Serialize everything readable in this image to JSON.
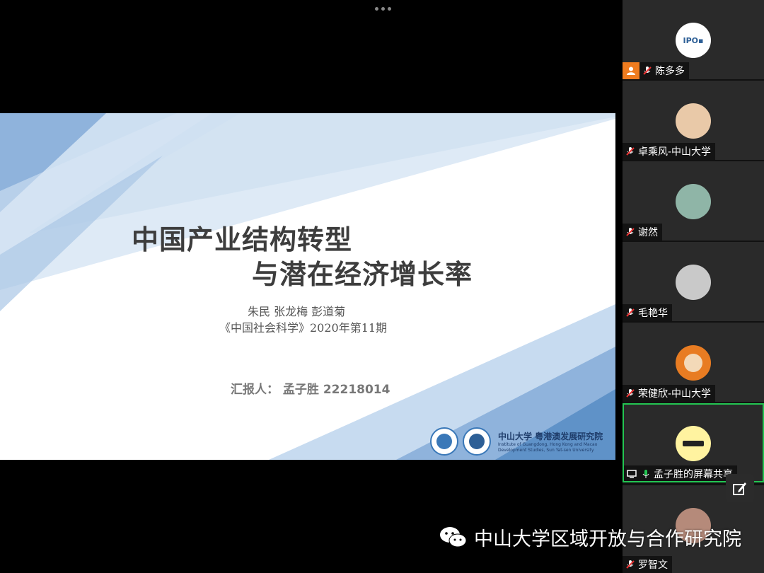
{
  "slide": {
    "title_line1": "中国产业结构转型",
    "title_line2": "与潜在经济增长率",
    "authors": "朱民 张龙梅 彭道菊",
    "journal": "《中国社会科学》2020年第11期",
    "presenter": "汇报人： 孟子胜 22218014",
    "logo_cn": "中山大学 粤港澳发展研究院",
    "logo_en_line1": "Institute of Guangdong, Hong Kong and Macao",
    "logo_en_line2": "Development Studies, Sun Yat-sen University"
  },
  "participants": [
    {
      "name": "陈多多",
      "avatar_label": "IPO▪"
    },
    {
      "name": "卓乘风-中山大学"
    },
    {
      "name": "谢然"
    },
    {
      "name": "毛艳华"
    },
    {
      "name": "荣健欣-中山大学"
    },
    {
      "name": "孟子胜的屏幕共享",
      "sharing": true
    },
    {
      "name": "罗智文"
    }
  ],
  "watermark": {
    "text": "中山大学区域开放与合作研究院",
    "icon": "wechat-icon"
  },
  "colors": {
    "active_border": "#23c552",
    "user_badge": "#f07c1f",
    "slide_blue": "#3a78b8"
  }
}
